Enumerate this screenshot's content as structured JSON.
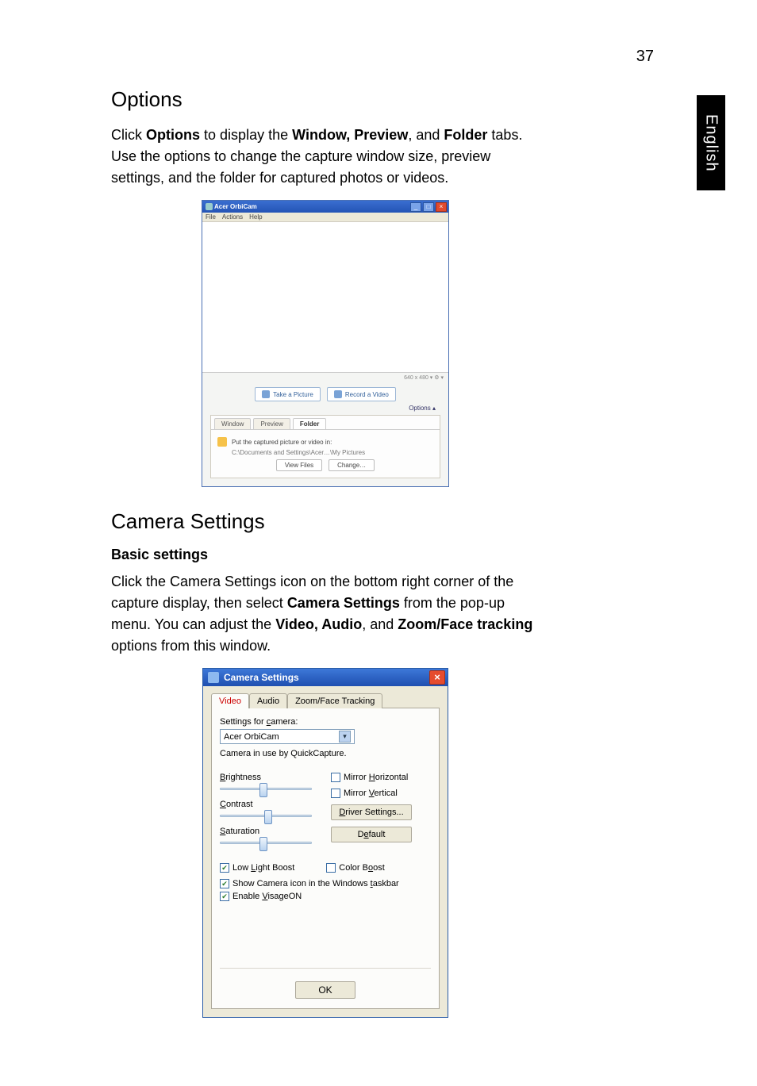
{
  "page_number": "37",
  "side_tab": "English",
  "section_options": {
    "heading": "Options",
    "body_prefix": "Click",
    "body_b1": "Options",
    "body_mid1": "to display the",
    "body_b2": "Window, Preview",
    "body_mid2": ", and",
    "body_b3": "Folder",
    "body_suffix": "tabs. Use the options to change the capture window size, preview settings, and the folder for captured photos or videos."
  },
  "orbicam": {
    "title": "Acer OrbiCam",
    "menu": [
      "File",
      "Actions",
      "Help"
    ],
    "status": "640 x 480 ▾   ⚙ ▾",
    "take_picture": "Take a Picture",
    "record_video": "Record a Video",
    "options_link": "Options ▴",
    "tabs": {
      "window": "Window",
      "preview": "Preview",
      "folder": "Folder"
    },
    "folder_line": "Put the captured picture or video in:",
    "folder_path": "C:\\Documents and Settings\\Acer…\\My Pictures",
    "view_files": "View Files",
    "change": "Change…"
  },
  "section_camera": {
    "heading": "Camera Settings",
    "subhead": "Basic settings",
    "body_prefix": "Click the Camera Settings icon on the bottom right corner of the capture display, then select",
    "body_b1": "Camera Settings",
    "body_mid1": "from the pop-up menu. You can adjust the",
    "body_b2": "Video, Audio",
    "body_mid2": ", and",
    "body_b3": "Zoom/Face tracking",
    "body_suffix": "options from this window."
  },
  "cam": {
    "title": "Camera Settings",
    "tabs": {
      "video": "Video",
      "audio": "Audio",
      "zoom": "Zoom/Face Tracking"
    },
    "settings_for": "Settings for camera:",
    "camera_name": "Acer OrbiCam",
    "in_use": "Camera in use by QuickCapture.",
    "brightness_lbl": "Brightness",
    "contrast_lbl": "Contrast",
    "saturation_lbl": "Saturation",
    "mirror_h": "Mirror Horizontal",
    "mirror_v": "Mirror Vertical",
    "driver_btn": "Driver Settings...",
    "default_btn": "Default",
    "low_light": "Low Light Boost",
    "color_boost": "Color Boost",
    "show_icon": "Show Camera icon in the Windows taskbar",
    "visageon": "Enable VisageON",
    "ok": "OK"
  }
}
